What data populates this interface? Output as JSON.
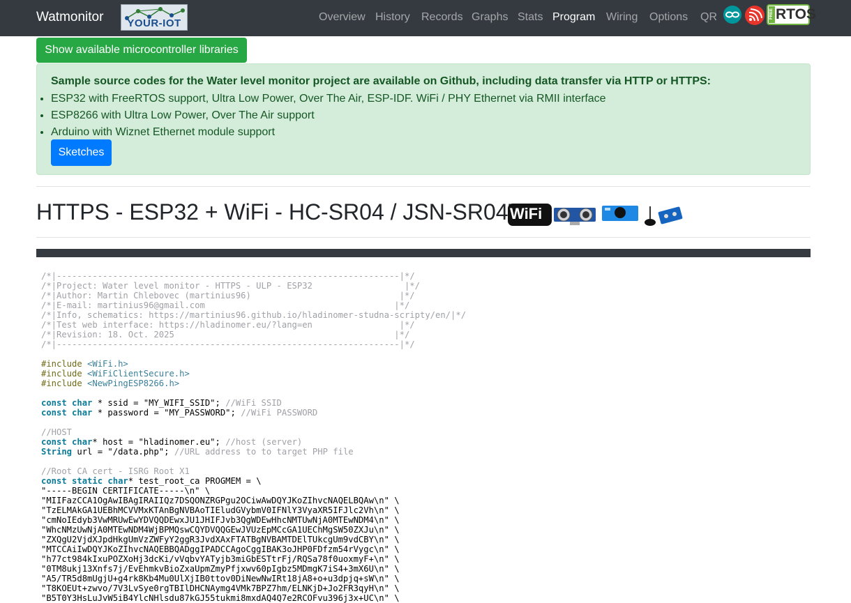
{
  "navbar": {
    "brand": "Watmonitor",
    "logo_text": "YOUR-IOT",
    "items": [
      "Overview",
      "History",
      "Records",
      "Graphs",
      "Stats",
      "Program",
      "Wiring",
      "Options",
      "QR"
    ],
    "active": "Program",
    "icons": [
      "arduino-icon",
      "espressif-icon",
      "freertos-logo"
    ],
    "rtos_text": "RTOS",
    "rtos_vertical": "FREE"
  },
  "libs_button": "Show available microcontroller libraries",
  "alert": {
    "intro": "Sample source codes for the Water level monitor project are available on Github, including data transfer via HTTP or HTTPS:",
    "items": [
      "ESP32 with FreeRTOS support, Ultra Low Power, Over The Air, ESP-IDF. WiFi / PHY Ethernet via RMII interface",
      "ESP8266 with Ultra Low Power, Over The Air support",
      "Arduino with Wiznet Ethernet module support"
    ],
    "button": "Sketches"
  },
  "heading": {
    "title": "HTTPS - ESP32 + WiFi - HC-SR04 / JSN-SR04T",
    "wifi_badge": "WiFi",
    "hardware_icons": [
      "wifi-badge-icon",
      "hc-sr04-sensor-icon",
      "hc-sr04-blue-module-icon",
      "jsn-sr04t-probe-icon"
    ]
  },
  "code": {
    "header_rule": "-------------------------------------------------------------------",
    "header": [
      "Project: Water level monitor - HTTPS - ULP - ESP32",
      "Author: Martin Chlebovec (martinius96)",
      "E-mail: martinius96@gmail.com",
      "Info, schematics: https://martinius96.github.io/hladinomer-studna-scripty/en/",
      "Test web interface: https://hladinomer.eu/?lang=en",
      "Revision: 18. Oct. 2025"
    ],
    "includes": [
      "<WiFi.h>",
      "<WiFiClientSecure.h>",
      "<NewPingESP8266.h>"
    ],
    "ssid_line": [
      "const",
      "char",
      " * ssid = ",
      "\"MY_WIFI_SSID\"",
      "; ",
      "//WiFi SSID"
    ],
    "password_line": [
      "const",
      "char",
      " * password = ",
      "\"MY_PASSWORD\"",
      "; ",
      "//WiFi PASSWORD"
    ],
    "host_comment": "//HOST",
    "host_line": [
      "const",
      "char",
      "* host = ",
      "\"hladinomer.eu\"",
      "; ",
      "//host (server)"
    ],
    "url_line": [
      "String",
      " url = ",
      "\"/data.php\"",
      "; ",
      "//URL address to to target PHP file"
    ],
    "ca_comment": "//Root CA cert - ISRG Root X1",
    "ca_decl": [
      "const",
      "static",
      "char",
      "* test_root_ca PROGMEM = \\"
    ],
    "cert_lines": [
      "\"-----BEGIN CERTIFICATE-----\\n\" \\",
      "\"MIIFazCCA1OgAwIBAgIRAIIQz7DSQONZRGPgu2OCiwAwDQYJKoZIhvcNAQELBQAw\\n\" \\",
      "\"TzELMAkGA1UEBhMCVVMxKTAnBgNVBAoTIEludGVybmV0IFNlY3VyaXR5IFJlc2Vh\\n\" \\",
      "\"cmNoIEdyb3VwMRUwEwYDVQQDEwxJU1JHIFJvb3QgWDEwHhcNMTUwNjA0MTEwNDM4\\n\" \\",
      "\"WhcNMzUwNjA0MTEwNDM4WjBPMQswCQYDVQQGEwJVUzEpMCcGA1UEChMgSW50ZXJu\\n\" \\",
      "\"ZXQgU2VjdXJpdHkgUmVzZWFyY2ggR3JvdXAxFTATBgNVBAMTDElTUkcgUm9vdCBY\\n\" \\",
      "\"MTCCAiIwDQYJKoZIhvcNAQEBBQADggIPADCCAgoCggIBAK3oJHP0FDfzm54rVygc\\n\" \\",
      "\"h77ct984kIxuPOZXoHj3dcKi/vVqbvYATyjb3miGbESTtrFj/RQSa78f0uoxmyF+\\n\" \\",
      "\"0TM8ukj13Xnfs7j/EvEhmkvBioZxaUpmZmyPfjxwv60pIgbz5MDmgK7iS4+3mX6U\\n\" \\",
      "\"A5/TR5d8mUgjU+g4rk8Kb4Mu0UlXjIB0ttov0DiNewNwIRt18jA8+o+u3dpjq+sW\\n\" \\",
      "\"T8KOEUt+zwvo/7V3LvSye0rgTBIlDHCNAymg4VMk7BPZ7hm/ELNKjD+Jo2FR3qyH\\n\" \\",
      "\"B5T0Y3HsLuJvW5iB4YlcNHlsdu87kGJ55tukmi8mxdAQ4Q7e2RCOFvu396j3x+UC\\n\" \\"
    ]
  }
}
